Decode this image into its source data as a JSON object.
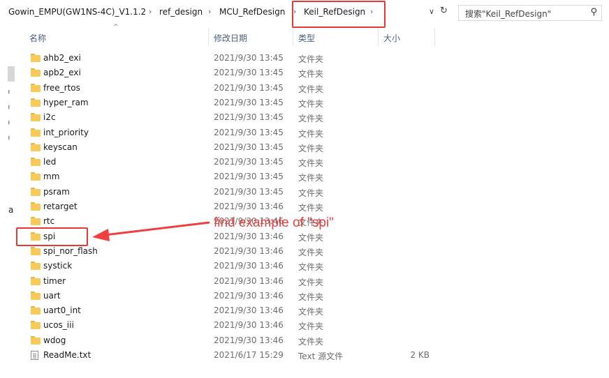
{
  "breadcrumb": [
    {
      "label": "Gowin_EMPU(GW1NS-4C)_V1.1.2"
    },
    {
      "label": "ref_design"
    },
    {
      "label": "MCU_RefDesign"
    },
    {
      "label": "Keil_RefDesign"
    }
  ],
  "search": {
    "placeholder": "搜索\"Keil_RefDesign\""
  },
  "columns": {
    "name": "名称",
    "date": "修改日期",
    "type": "类型",
    "size": "大小"
  },
  "nav": {
    "letter": "a"
  },
  "files": [
    {
      "name": "ahb2_exi",
      "date": "2021/9/30 13:45",
      "type": "文件夹",
      "size": "",
      "icon": "folder-icon"
    },
    {
      "name": "apb2_exi",
      "date": "2021/9/30 13:45",
      "type": "文件夹",
      "size": "",
      "icon": "folder-icon"
    },
    {
      "name": "free_rtos",
      "date": "2021/9/30 13:45",
      "type": "文件夹",
      "size": "",
      "icon": "folder-icon"
    },
    {
      "name": "hyper_ram",
      "date": "2021/9/30 13:45",
      "type": "文件夹",
      "size": "",
      "icon": "folder-icon"
    },
    {
      "name": "i2c",
      "date": "2021/9/30 13:45",
      "type": "文件夹",
      "size": "",
      "icon": "folder-icon"
    },
    {
      "name": "int_priority",
      "date": "2021/9/30 13:45",
      "type": "文件夹",
      "size": "",
      "icon": "folder-icon"
    },
    {
      "name": "keyscan",
      "date": "2021/9/30 13:45",
      "type": "文件夹",
      "size": "",
      "icon": "folder-icon"
    },
    {
      "name": "led",
      "date": "2021/9/30 13:45",
      "type": "文件夹",
      "size": "",
      "icon": "folder-icon"
    },
    {
      "name": "mm",
      "date": "2021/9/30 13:45",
      "type": "文件夹",
      "size": "",
      "icon": "folder-icon"
    },
    {
      "name": "psram",
      "date": "2021/9/30 13:45",
      "type": "文件夹",
      "size": "",
      "icon": "folder-icon"
    },
    {
      "name": "retarget",
      "date": "2021/9/30 13:46",
      "type": "文件夹",
      "size": "",
      "icon": "folder-icon"
    },
    {
      "name": "rtc",
      "date": "2021/9/30 13:46",
      "type": "文件夹",
      "size": "",
      "icon": "folder-icon"
    },
    {
      "name": "spi",
      "date": "2021/9/30 13:46",
      "type": "文件夹",
      "size": "",
      "icon": "folder-icon"
    },
    {
      "name": "spi_nor_flash",
      "date": "2021/9/30 13:46",
      "type": "文件夹",
      "size": "",
      "icon": "folder-icon"
    },
    {
      "name": "systick",
      "date": "2021/9/30 13:46",
      "type": "文件夹",
      "size": "",
      "icon": "folder-icon"
    },
    {
      "name": "timer",
      "date": "2021/9/30 13:46",
      "type": "文件夹",
      "size": "",
      "icon": "folder-icon"
    },
    {
      "name": "uart",
      "date": "2021/9/30 13:46",
      "type": "文件夹",
      "size": "",
      "icon": "folder-icon"
    },
    {
      "name": "uart0_int",
      "date": "2021/9/30 13:46",
      "type": "文件夹",
      "size": "",
      "icon": "folder-icon"
    },
    {
      "name": "ucos_iii",
      "date": "2021/9/30 13:46",
      "type": "文件夹",
      "size": "",
      "icon": "folder-icon"
    },
    {
      "name": "wdog",
      "date": "2021/9/30 13:46",
      "type": "文件夹",
      "size": "",
      "icon": "folder-icon"
    },
    {
      "name": "ReadMe.txt",
      "date": "2021/6/17 15:29",
      "type": "Text 源文件",
      "size": "2 KB",
      "icon": "text-file-icon"
    }
  ],
  "annotation": {
    "text": "find example of \"spi\"",
    "color": "#ee4040"
  }
}
